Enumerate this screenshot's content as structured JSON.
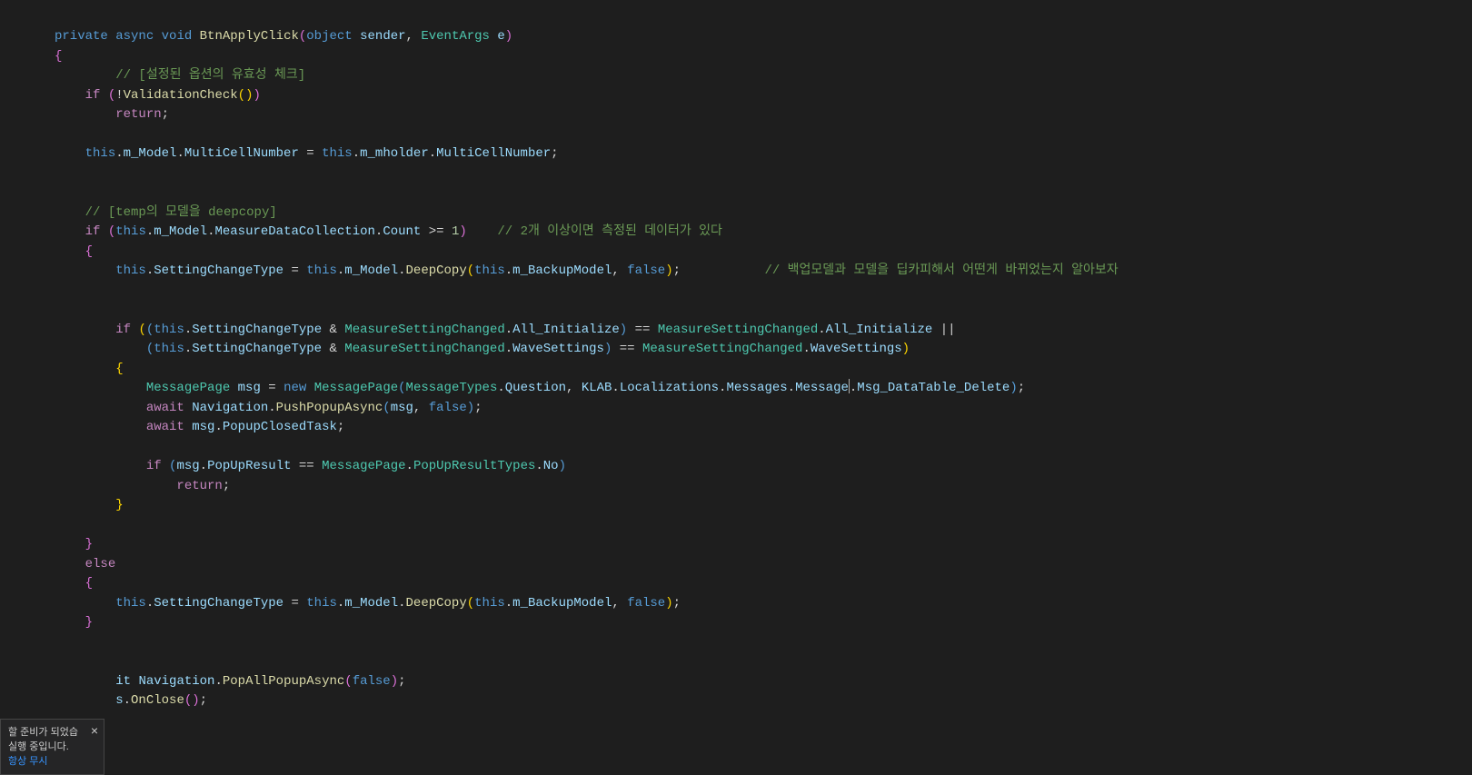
{
  "code": {
    "t_private": "private",
    "t_async": "async",
    "t_void": "void",
    "t_BtnApplyClick": "BtnApplyClick",
    "t_object": "object",
    "t_sender": "sender",
    "t_EventArgs": "EventArgs",
    "t_e": "e",
    "c_validity": "// [설정된 옵션의 유효성 체크]",
    "t_if": "if",
    "t_ValidationCheck": "ValidationCheck",
    "t_return": "return",
    "t_this": "this",
    "t_m_Model": "m_Model",
    "t_MultiCellNumber": "MultiCellNumber",
    "t_m_mholder": "m_mholder",
    "c_deepcopy": "// [temp의 모델을 deepcopy]",
    "t_MeasureDataCollection": "MeasureDataCollection",
    "t_Count": "Count",
    "n_1": "1",
    "c_two_or_more": "// 2개 이상이면 측정된 데이터가 있다",
    "t_SettingChangeType": "SettingChangeType",
    "t_DeepCopy": "DeepCopy",
    "t_m_BackupModel": "m_BackupModel",
    "t_false": "false",
    "c_backup": "// 백업모델과 모델을 딥카피해서 어떤게 바뀌었는지 알아보자",
    "t_MeasureSettingChanged": "MeasureSettingChanged",
    "t_All_Initialize": "All_Initialize",
    "t_WaveSettings": "WaveSettings",
    "t_MessagePage": "MessagePage",
    "t_msg": "msg",
    "t_new": "new",
    "t_MessageTypes": "MessageTypes",
    "t_Question": "Question",
    "t_KLAB": "KLAB",
    "t_Localizations": "Localizations",
    "t_Messages": "Messages",
    "t_Message": "Message",
    "t_Msg_DataTable_Delete": "Msg_DataTable_Delete",
    "t_await": "await",
    "t_Navigation": "Navigation",
    "t_PushPopupAsync": "PushPopupAsync",
    "t_PopupClosedTask": "PopupClosedTask",
    "t_PopUpResult": "PopUpResult",
    "t_PopUpResultTypes": "PopUpResultTypes",
    "t_No": "No",
    "t_else": "else",
    "t_it": "it",
    "t_PopAllPopupAsync": "PopAllPopupAsync",
    "t_s": "s",
    "t_OnClose": "OnClose"
  },
  "notification": {
    "line1": "할 준비가 되었습",
    "line2": "실행 중입니다.",
    "link": "항상 무시",
    "close": "×"
  }
}
